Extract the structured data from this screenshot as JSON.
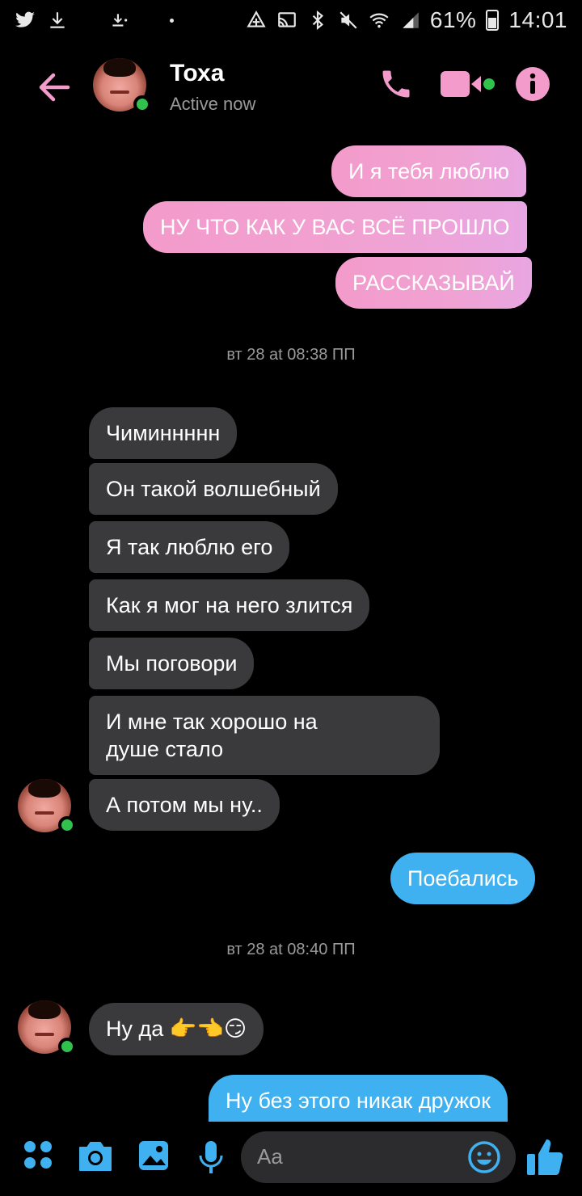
{
  "status_bar": {
    "battery": "61%",
    "time": "14:01"
  },
  "header": {
    "name": "Тоха",
    "status": "Active now"
  },
  "messages": {
    "m1": "И я тебя люблю",
    "m2": "НУ ЧТО КАК У ВАС ВСЁ ПРОШЛО",
    "m3": "РАССКАЗЫВАЙ",
    "ts1": "вт 28 at 08:38 ПП",
    "m4": "Чиминнннн",
    "m5": "Он такой волшебный",
    "m6": "Я так люблю его",
    "m7": "Как я мог на него злится",
    "m8": "Мы поговори",
    "m9_line1": "И мне так хорошо на",
    "m9_line2": "душе стало",
    "m10": "А потом мы ну..",
    "m11": "Поебались",
    "ts2": "вт 28 at 08:40 ПП",
    "m12": "Ну да",
    "m12_emoji": "👉👈😏",
    "m13": "Ну без этого никак дружок"
  },
  "composer": {
    "placeholder": "Aa"
  },
  "colors": {
    "accent_pink": "#f39bcb",
    "accent_blue": "#3fb0f0",
    "incoming_bubble": "#3a3a3c",
    "online": "#31c24d"
  },
  "icons": [
    "twitter-icon",
    "download-icon",
    "download-small-icon",
    "dot-icon",
    "data-saver-icon",
    "cast-icon",
    "bluetooth-icon",
    "mute-icon",
    "wifi-icon",
    "signal-icon",
    "battery-icon",
    "back-arrow-icon",
    "phone-icon",
    "video-icon",
    "info-icon",
    "apps-icon",
    "camera-icon",
    "image-icon",
    "microphone-icon",
    "emoji-icon",
    "thumbs-up-icon"
  ]
}
